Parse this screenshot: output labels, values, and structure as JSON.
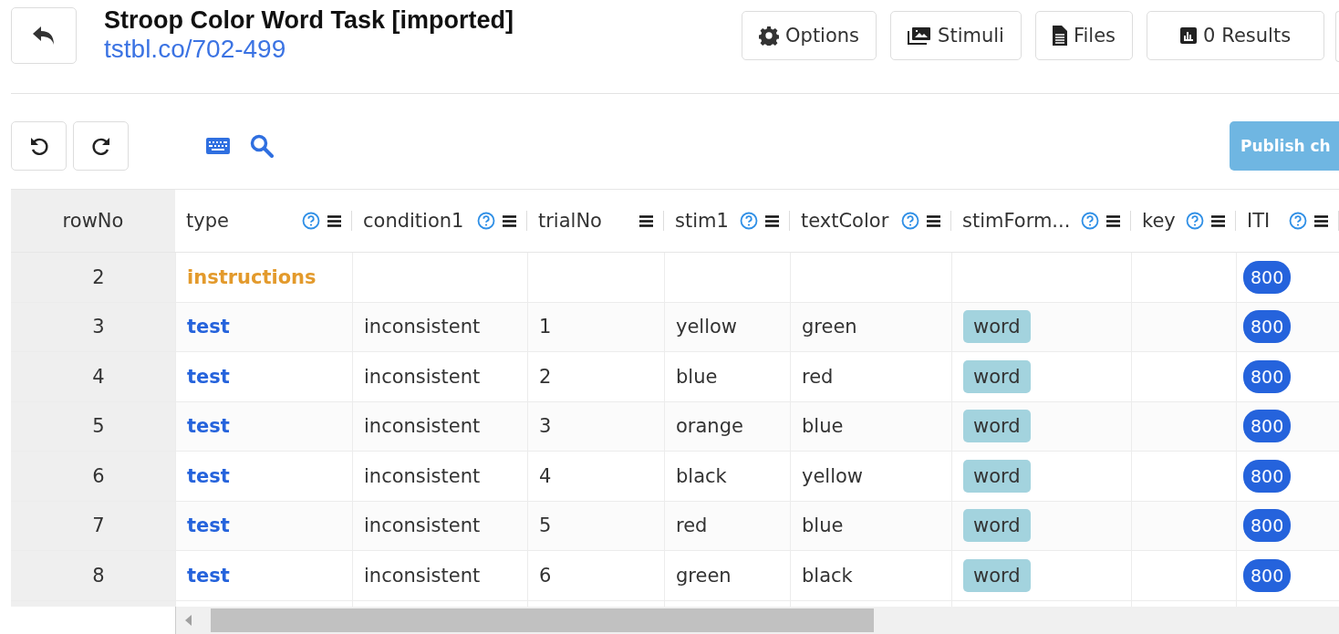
{
  "header": {
    "title": "Stroop Color Word Task [imported]",
    "link": "tstbl.co/702-499",
    "buttons": [
      {
        "label": "Options"
      },
      {
        "label": "Stimuli"
      },
      {
        "label": "Files"
      },
      {
        "count": "0",
        "label": "Results"
      }
    ]
  },
  "toolbar": {
    "publish": {
      "label": "Publish ch",
      "disabled": true
    }
  },
  "table": {
    "columns": [
      {
        "label": "rowNo",
        "kind": "index"
      },
      {
        "label": "type",
        "help": true
      },
      {
        "label": "condition1",
        "help": true
      },
      {
        "label": "trialNo",
        "help": false
      },
      {
        "label": "stim1",
        "help": true
      },
      {
        "label": "textColor",
        "help": true
      },
      {
        "label": "stimForm...",
        "help": true
      },
      {
        "label": "key",
        "help": true
      },
      {
        "label": "ITI",
        "help": true
      }
    ],
    "rows": [
      {
        "cells": [
          {
            "kind": "index",
            "text": "2"
          },
          {
            "kind": "type",
            "text": "instructions",
            "color": "#e39a2c"
          },
          null,
          null,
          null,
          null,
          null,
          null,
          {
            "kind": "pill",
            "text": "800"
          }
        ]
      },
      {
        "cells": [
          {
            "kind": "index",
            "text": "3"
          },
          {
            "kind": "type",
            "text": "test",
            "color": "#2563dc"
          },
          {
            "kind": "text",
            "text": "inconsistent"
          },
          {
            "kind": "text",
            "text": "1"
          },
          {
            "kind": "text",
            "text": "yellow"
          },
          {
            "kind": "text",
            "text": "green"
          },
          {
            "kind": "tag",
            "text": "word"
          },
          null,
          {
            "kind": "pill",
            "text": "800"
          }
        ]
      },
      {
        "cells": [
          {
            "kind": "index",
            "text": "4"
          },
          {
            "kind": "type",
            "text": "test",
            "color": "#2563dc"
          },
          {
            "kind": "text",
            "text": "inconsistent"
          },
          {
            "kind": "text",
            "text": "2"
          },
          {
            "kind": "text",
            "text": "blue"
          },
          {
            "kind": "text",
            "text": "red"
          },
          {
            "kind": "tag",
            "text": "word"
          },
          null,
          {
            "kind": "pill",
            "text": "800"
          }
        ]
      },
      {
        "cells": [
          {
            "kind": "index",
            "text": "5"
          },
          {
            "kind": "type",
            "text": "test",
            "color": "#2563dc"
          },
          {
            "kind": "text",
            "text": "inconsistent"
          },
          {
            "kind": "text",
            "text": "3"
          },
          {
            "kind": "text",
            "text": "orange"
          },
          {
            "kind": "text",
            "text": "blue"
          },
          {
            "kind": "tag",
            "text": "word"
          },
          null,
          {
            "kind": "pill",
            "text": "800"
          }
        ]
      },
      {
        "cells": [
          {
            "kind": "index",
            "text": "6"
          },
          {
            "kind": "type",
            "text": "test",
            "color": "#2563dc"
          },
          {
            "kind": "text",
            "text": "inconsistent"
          },
          {
            "kind": "text",
            "text": "4"
          },
          {
            "kind": "text",
            "text": "black"
          },
          {
            "kind": "text",
            "text": "yellow"
          },
          {
            "kind": "tag",
            "text": "word"
          },
          null,
          {
            "kind": "pill",
            "text": "800"
          }
        ]
      },
      {
        "cells": [
          {
            "kind": "index",
            "text": "7"
          },
          {
            "kind": "type",
            "text": "test",
            "color": "#2563dc"
          },
          {
            "kind": "text",
            "text": "inconsistent"
          },
          {
            "kind": "text",
            "text": "5"
          },
          {
            "kind": "text",
            "text": "red"
          },
          {
            "kind": "text",
            "text": "blue"
          },
          {
            "kind": "tag",
            "text": "word"
          },
          null,
          {
            "kind": "pill",
            "text": "800"
          }
        ]
      },
      {
        "cells": [
          {
            "kind": "index",
            "text": "8"
          },
          {
            "kind": "type",
            "text": "test",
            "color": "#2563dc"
          },
          {
            "kind": "text",
            "text": "inconsistent"
          },
          {
            "kind": "text",
            "text": "6"
          },
          {
            "kind": "text",
            "text": "green"
          },
          {
            "kind": "text",
            "text": "black"
          },
          {
            "kind": "tag",
            "text": "word"
          },
          null,
          {
            "kind": "pill",
            "text": "800"
          }
        ]
      }
    ]
  }
}
